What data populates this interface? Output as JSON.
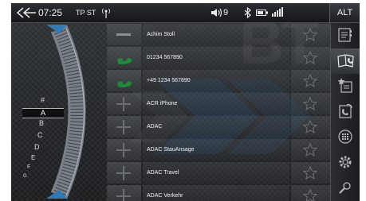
{
  "status": {
    "time": "07:25",
    "tp_st": "TP ST",
    "volume": "9",
    "alt_label": "ALT"
  },
  "watermark": "BT",
  "alphabet": {
    "selected": "A",
    "letters": [
      "#",
      "B",
      "C",
      "D",
      "E",
      "F",
      "G"
    ]
  },
  "contacts": [
    {
      "name": "Achim Stoll",
      "icon": "minus-icon"
    },
    {
      "name": "01234 567890",
      "icon": "phone-handset-icon"
    },
    {
      "name": "+49 1234 567890",
      "icon": "phone-handset-icon"
    },
    {
      "name": "ACR iPhone",
      "icon": "plus-icon"
    },
    {
      "name": "ADAC",
      "icon": "plus-icon"
    },
    {
      "name": "ADAC StauAnsage",
      "icon": "plus-icon"
    },
    {
      "name": "ADAC Travel",
      "icon": "plus-icon"
    },
    {
      "name": "ADAC Verkehr",
      "icon": "plus-icon"
    }
  ],
  "sidebar": [
    "contact-card-icon",
    "phonebook-icon",
    "favorites-list-icon",
    "call-history-icon",
    "keypad-icon",
    "settings-gear-icon",
    "search-icon"
  ],
  "colors": {
    "call_green": "#1f8a3a",
    "accent_blue": "#2f7bb8"
  }
}
